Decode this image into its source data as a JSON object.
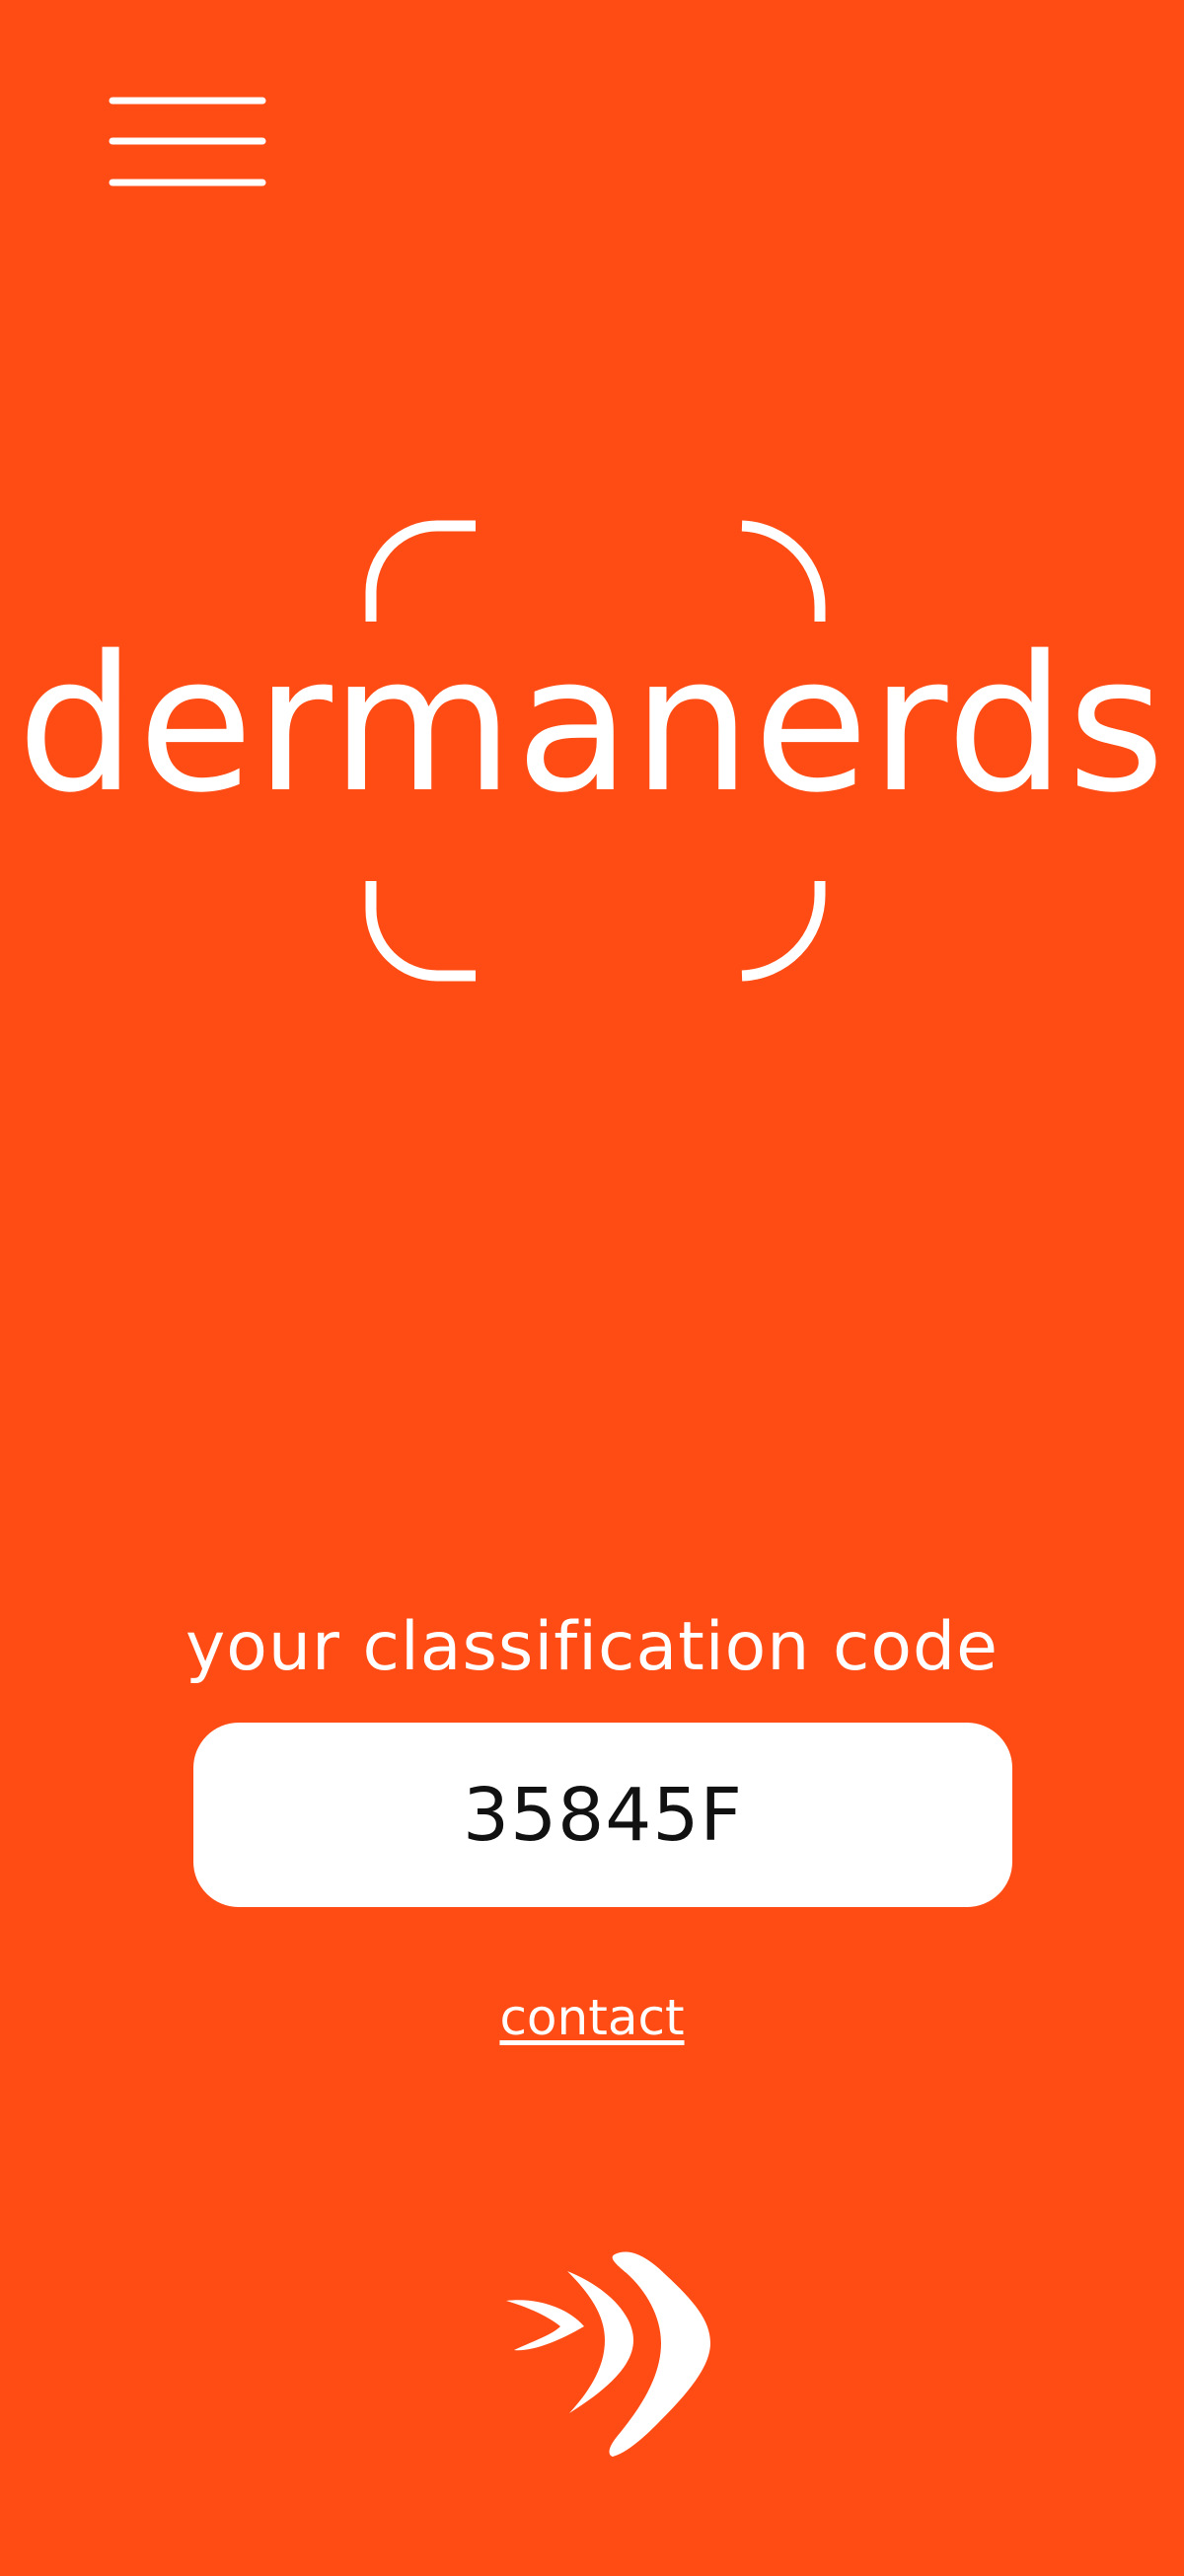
{
  "colors": {
    "background": "#FF4C14",
    "foreground": "#FFFFFF",
    "code_text": "#111111"
  },
  "header": {
    "menu_icon": "hamburger-menu-icon"
  },
  "logo": {
    "brand_name": "dermanerds",
    "frame_icon": "scan-frame-icon"
  },
  "classification": {
    "label": "your classification code",
    "code": "35845F"
  },
  "footer": {
    "contact_label": "contact",
    "next_icon": "double-chevron-right-icon"
  }
}
